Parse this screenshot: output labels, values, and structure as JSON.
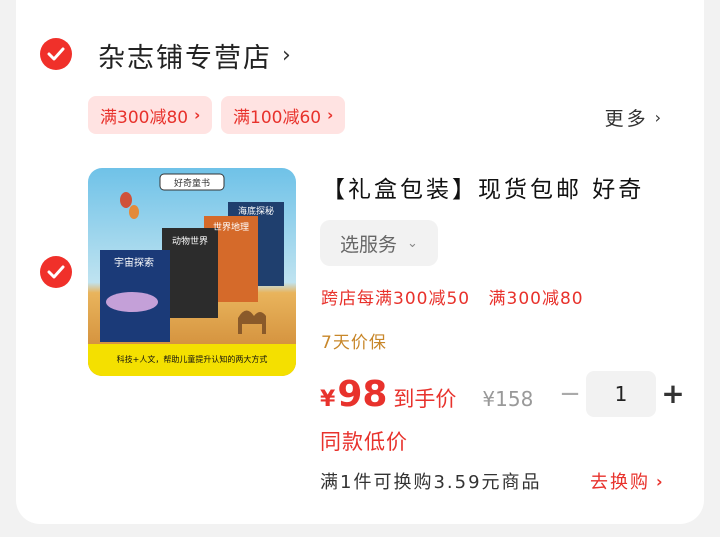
{
  "store": {
    "name": "杂志铺专营店",
    "chevron": "›",
    "checkbox_state": "checked"
  },
  "coupons": [
    {
      "label": "满300减80",
      "arrow": "›"
    },
    {
      "label": "满100减60",
      "arrow": "›"
    }
  ],
  "more": {
    "label": "更多",
    "arrow": "›"
  },
  "product": {
    "checkbox_state": "checked",
    "image": {
      "badge": "好奇童书",
      "book_titles": [
        "宇宙探索",
        "动物世界",
        "世界地理",
        "海底探秘"
      ],
      "caption": "科技+人文，帮助儿童提升认知的两大方式"
    },
    "title": "【礼盒包装】现货包邮 好奇",
    "service": {
      "label": "选服务",
      "chevron": "⌄"
    },
    "promos": [
      "跨店每满300减50",
      "满300减80"
    ],
    "guarantee": "7天价保",
    "price": {
      "currency": "¥",
      "amount": "98",
      "label": "到手价",
      "original": "¥158"
    },
    "quantity": {
      "minus": "−",
      "value": "1",
      "plus": "+"
    },
    "low_price_tag": "同款低价",
    "swap": {
      "text": "满1件可换购3.59元商品",
      "action": "去换购",
      "arrow": "›"
    }
  },
  "colors": {
    "accent": "#e8322c",
    "check": "#f0302a",
    "coupon_bg": "#ffe3e2",
    "guarantee": "#c8872a"
  }
}
